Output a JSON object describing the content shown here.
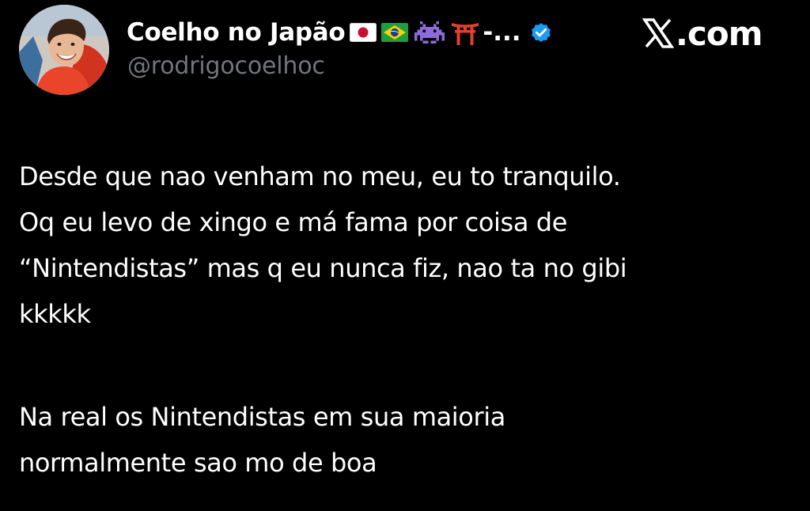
{
  "author": {
    "display_name": "Coelho no Japão",
    "name_suffix": "-...",
    "handle": "@rodrigocoelhoc",
    "verified": true,
    "avatar": "avatar-photo",
    "flags": [
      "japan-flag-icon",
      "brazil-flag-icon"
    ],
    "emojis": [
      "space-invader-emoji-icon",
      "torii-gate-emoji-icon"
    ]
  },
  "brand": {
    "text": ".com",
    "logo": "x-logo-icon"
  },
  "tweet": {
    "paragraph1": [
      "Desde que nao venham no meu, eu to tranquilo.",
      "Oq eu levo de xingo e má fama por coisa de",
      "“Nintendistas” mas q eu nunca fiz, nao ta no gibi",
      "kkkkk"
    ],
    "paragraph2": [
      "Na real os Nintendistas em sua maioria",
      "normalmente sao mo de boa"
    ]
  },
  "colors": {
    "background": "#000000",
    "text": "#ffffff",
    "secondary_text": "#71767b",
    "verified_badge": "#1d9bf0"
  }
}
